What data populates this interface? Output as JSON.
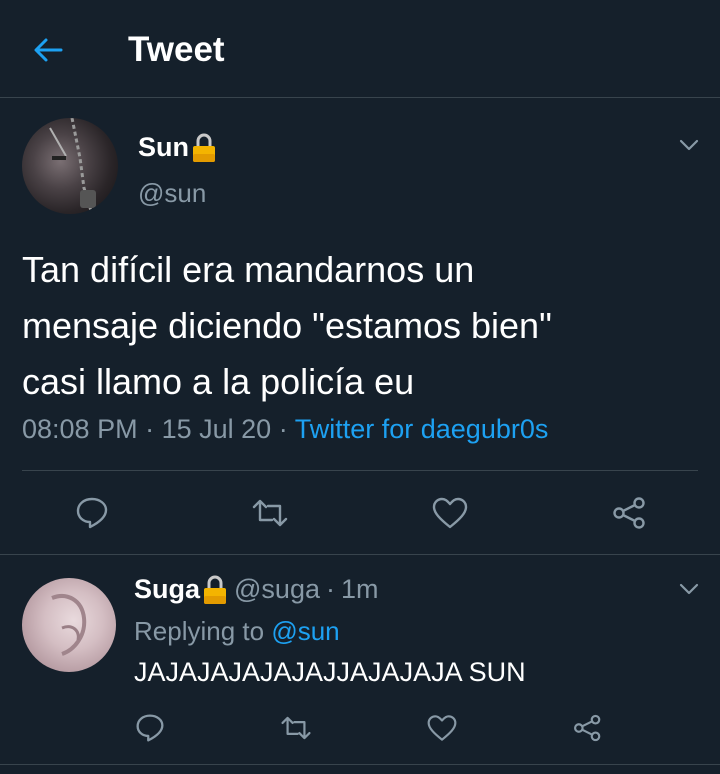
{
  "header": {
    "title": "Tweet",
    "back_icon": "arrow-left-icon"
  },
  "colors": {
    "background": "#15202b",
    "accent": "#1da1f2",
    "muted": "#8899a6",
    "divider": "#38444d"
  },
  "tweet": {
    "display_name": "Sun",
    "handle": "@sun",
    "text_lines": [
      "Tan difícil era mandarnos un",
      "mensaje diciendo \"estamos bien\"",
      "casi llamo a la policía eu"
    ],
    "time": "08:08 PM",
    "date": "15 Jul 20",
    "separator": "·",
    "source": "Twitter for daegubr0s",
    "actions": [
      "reply-icon",
      "retweet-icon",
      "like-icon",
      "share-icon"
    ]
  },
  "reply": {
    "display_name": "Suga",
    "handle": "@suga",
    "time": "1m",
    "separator": "·",
    "replying_prefix": "Replying to",
    "replying_to": "@sun",
    "text": "JAJAJAJAJAJAJJAJAJAJA SUN",
    "actions": [
      "reply-icon",
      "retweet-icon",
      "like-icon",
      "share-icon"
    ]
  }
}
